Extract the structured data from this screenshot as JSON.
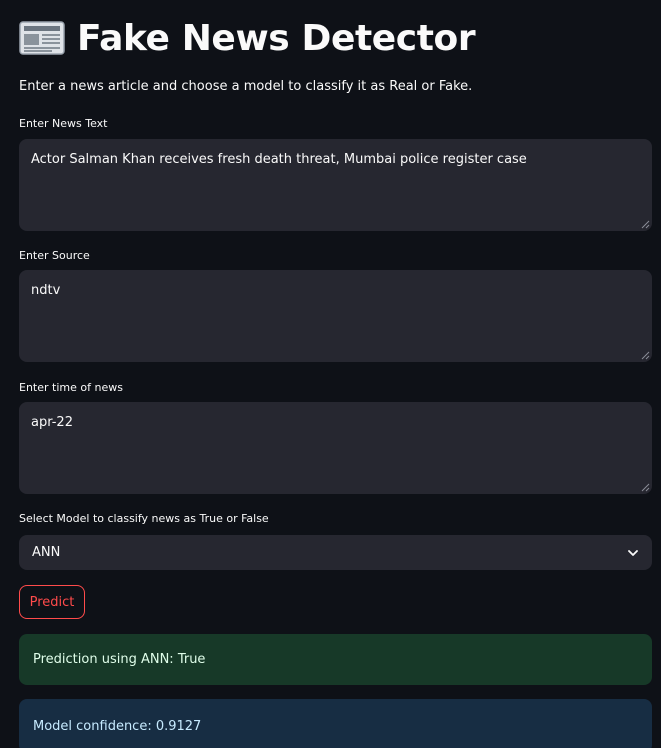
{
  "header": {
    "title": "Fake News Detector",
    "icon": "newspaper-icon",
    "subtitle": "Enter a news article and choose a model to classify it as Real or Fake."
  },
  "form": {
    "news_text": {
      "label": "Enter News Text",
      "value": "Actor Salman Khan receives fresh death threat, Mumbai police register case"
    },
    "source": {
      "label": "Enter Source",
      "value": "ndtv"
    },
    "time": {
      "label": "Enter time of news",
      "value": "apr-22"
    },
    "model": {
      "label": "Select Model to classify news as True or False",
      "selected": "ANN"
    },
    "predict_label": "Predict"
  },
  "results": {
    "prediction": "Prediction using ANN: True",
    "confidence": "Model confidence: 0.9127"
  },
  "colors": {
    "background": "#0e1117",
    "input_bg": "#262730",
    "accent": "#ff4b4b",
    "success_bg": "#173928",
    "info_bg": "#172d43"
  }
}
